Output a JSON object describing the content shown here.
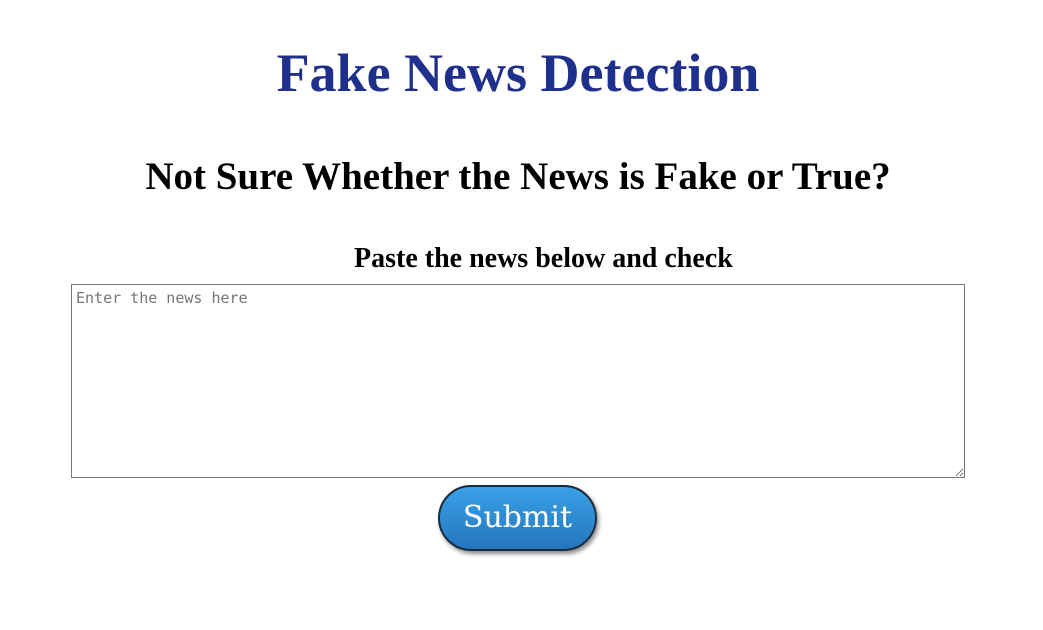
{
  "header": {
    "title": "Fake News Detection",
    "subtitle": "Not Sure Whether the News is Fake or True?"
  },
  "form": {
    "instruction": "Paste the news below and check",
    "news_input": {
      "placeholder": "Enter the news here",
      "value": ""
    },
    "submit_label": "Submit"
  },
  "colors": {
    "title": "#1f2f8c",
    "button_top": "#3aa1e6",
    "button_bottom": "#2476bf"
  }
}
